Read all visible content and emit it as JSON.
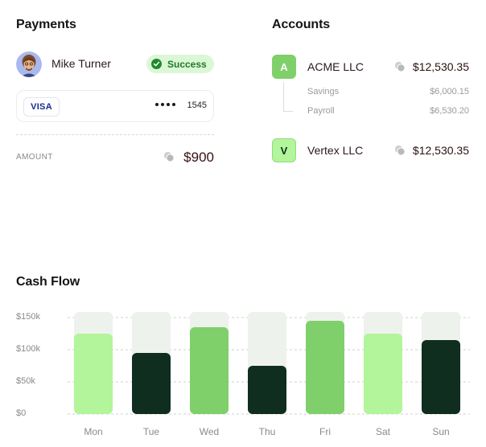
{
  "payments": {
    "title": "Payments",
    "payer_name": "Mike Turner",
    "status": "Success",
    "card_brand": "VISA",
    "card_mask": "••••",
    "card_last4": "1545",
    "amount_label": "AMOUNT",
    "amount_value": "$900"
  },
  "accounts": {
    "title": "Accounts",
    "items": [
      {
        "initial": "A",
        "name": "ACME LLC",
        "balance": "$12,530.35",
        "color": "#7fd06a",
        "sub": [
          {
            "label": "Savings",
            "amount": "$6,000.15"
          },
          {
            "label": "Payroll",
            "amount": "$6,530.20"
          }
        ]
      },
      {
        "initial": "V",
        "name": "Vertex LLC",
        "balance": "$12,530.35",
        "color": "#b2f59b",
        "sub": []
      }
    ]
  },
  "cashflow": {
    "title": "Cash Flow",
    "colors": {
      "light": "#b2f59b",
      "mid": "#7fd06a",
      "dark": "#0f2e1f",
      "track": "#eef2ed"
    },
    "chart_data": {
      "type": "bar",
      "categories": [
        "Mon",
        "Tue",
        "Wed",
        "Thu",
        "Fri",
        "Sat",
        "Sun"
      ],
      "values": [
        125000,
        95000,
        135000,
        75000,
        145000,
        125000,
        115000
      ],
      "bar_colors": [
        "light",
        "dark",
        "mid",
        "dark",
        "mid",
        "light",
        "dark"
      ],
      "ylim": [
        0,
        160000
      ],
      "yticks": [
        0,
        50000,
        100000,
        150000
      ],
      "ytick_labels": [
        "$0",
        "$50k",
        "$100k",
        "$150k"
      ],
      "grid": true,
      "title": "",
      "xlabel": "",
      "ylabel": ""
    }
  }
}
